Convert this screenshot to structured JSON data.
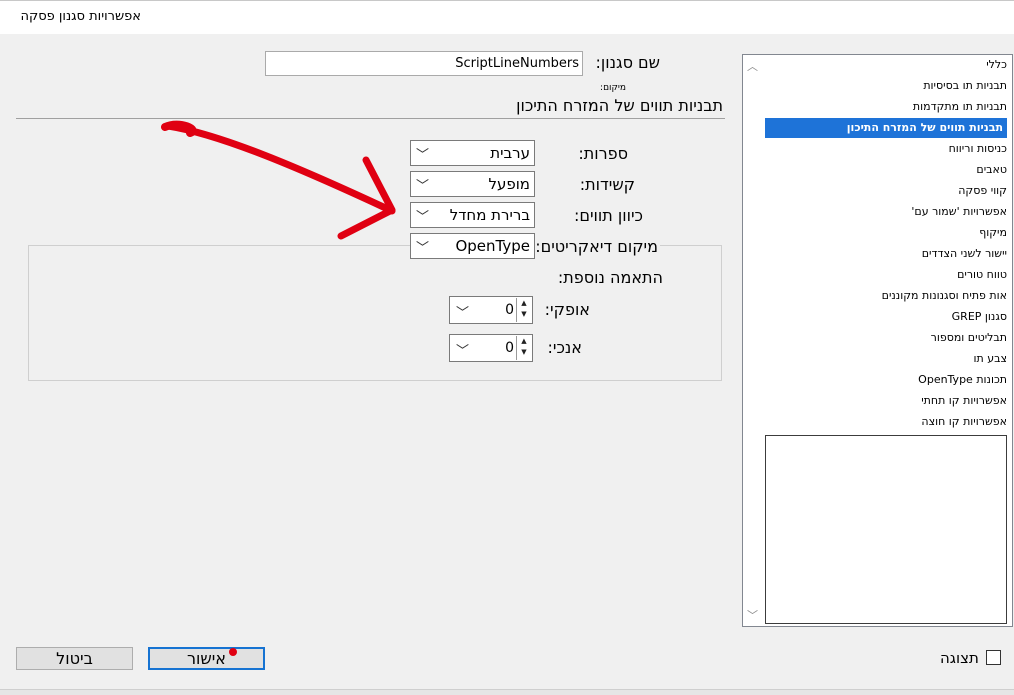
{
  "window": {
    "title": "אפשרויות סגנון פסקה"
  },
  "categories": [
    "כללי",
    "תבניות תו בסיסיות",
    "תבניות תו מתקדמות",
    "תבניות תווים של המזרח התיכון",
    "כניסות וריווח",
    "טאבים",
    "קווי פסקה",
    "אפשרויות 'שמור עם'",
    "מיקוף",
    "יישור לשני הצדדים",
    "טווח טורים",
    "אות פתיח וסגנונות מקוננים",
    "סגנון GREP",
    "תבליטים ומספור",
    "צבע תו",
    "תכונות OpenType",
    "אפשרויות קו תחתי",
    "אפשרויות קו חוצה"
  ],
  "selected_category_index": 3,
  "style_name": {
    "label": "שם סגנון:",
    "value": "ScriptLineNumbers"
  },
  "location": {
    "label": "מיקום:"
  },
  "section_title": "תבניות תווים של המזרח התיכון",
  "fields": {
    "digits": {
      "label": "ספרות:",
      "value": "ערבית"
    },
    "kashidas": {
      "label": "קשידות:",
      "value": "מופעל"
    },
    "char_direction": {
      "label": "כיוון תווים:",
      "value": "ברירת מחדל"
    },
    "diacritic_position": {
      "label": "מיקום דיאקריטים:",
      "value": "OpenType"
    }
  },
  "extra_adjust": {
    "label": "התאמה נוספת:",
    "horizontal": {
      "label": "אופקי:",
      "value": "0"
    },
    "vertical": {
      "label": "אנכי:",
      "value": "0"
    }
  },
  "buttons": {
    "ok": "אישור",
    "cancel": "ביטול"
  },
  "preview": {
    "label": "תצוגה",
    "checked": false
  },
  "colors": {
    "selection": "#1e73d8",
    "annotation": "#e00012",
    "ok_border": "#1673d2"
  },
  "icons": [
    "chevron-down-icon",
    "spin-up-icon",
    "spin-down-icon",
    "scroll-up-icon",
    "scroll-down-icon",
    "checkbox-icon"
  ]
}
